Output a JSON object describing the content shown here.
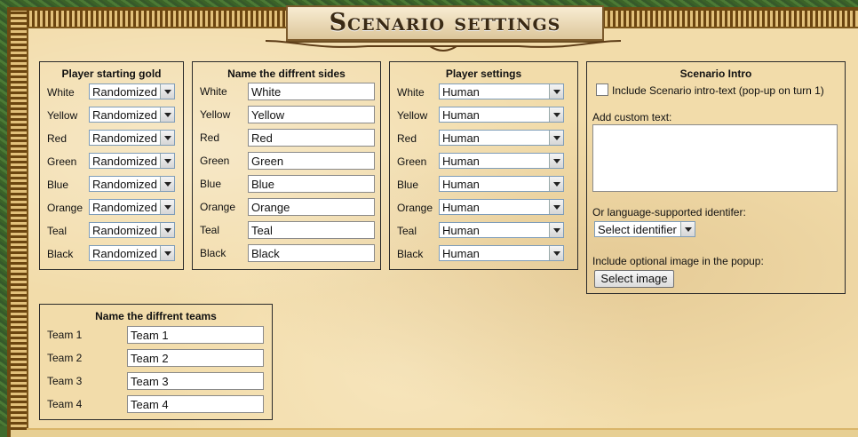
{
  "header": {
    "title": "Scenario settings"
  },
  "colors": [
    "White",
    "Yellow",
    "Red",
    "Green",
    "Blue",
    "Orange",
    "Teal",
    "Black"
  ],
  "gold_panel": {
    "title": "Player starting gold",
    "rows": [
      {
        "label": "White",
        "value": "Randomized"
      },
      {
        "label": "Yellow",
        "value": "Randomized"
      },
      {
        "label": "Red",
        "value": "Randomized"
      },
      {
        "label": "Green",
        "value": "Randomized"
      },
      {
        "label": "Blue",
        "value": "Randomized"
      },
      {
        "label": "Orange",
        "value": "Randomized"
      },
      {
        "label": "Teal",
        "value": "Randomized"
      },
      {
        "label": "Black",
        "value": "Randomized"
      }
    ]
  },
  "sides_panel": {
    "title": "Name the diffrent sides",
    "rows": [
      {
        "label": "White",
        "value": "White"
      },
      {
        "label": "Yellow",
        "value": "Yellow"
      },
      {
        "label": "Red",
        "value": "Red"
      },
      {
        "label": "Green",
        "value": "Green"
      },
      {
        "label": "Blue",
        "value": "Blue"
      },
      {
        "label": "Orange",
        "value": "Orange"
      },
      {
        "label": "Teal",
        "value": "Teal"
      },
      {
        "label": "Black",
        "value": "Black"
      }
    ]
  },
  "player_panel": {
    "title": "Player settings",
    "rows": [
      {
        "label": "White",
        "value": "Human"
      },
      {
        "label": "Yellow",
        "value": "Human"
      },
      {
        "label": "Red",
        "value": "Human"
      },
      {
        "label": "Green",
        "value": "Human"
      },
      {
        "label": "Blue",
        "value": "Human"
      },
      {
        "label": "Orange",
        "value": "Human"
      },
      {
        "label": "Teal",
        "value": "Human"
      },
      {
        "label": "Black",
        "value": "Human"
      }
    ]
  },
  "intro_panel": {
    "title": "Scenario Intro",
    "checkbox_label": "Include Scenario intro-text (pop-up on turn 1)",
    "custom_text_label": "Add custom text:",
    "custom_text_value": "",
    "identifier_label": "Or language-supported identifer:",
    "identifier_value": "Select identifier",
    "image_label": "Include optional image in the popup:",
    "image_button": "Select image"
  },
  "teams_panel": {
    "title": "Name the diffrent teams",
    "rows": [
      {
        "label": "Team 1",
        "value": "Team 1"
      },
      {
        "label": "Team 2",
        "value": "Team 2"
      },
      {
        "label": "Team 3",
        "value": "Team 3"
      },
      {
        "label": "Team 4",
        "value": "Team 4"
      }
    ]
  }
}
